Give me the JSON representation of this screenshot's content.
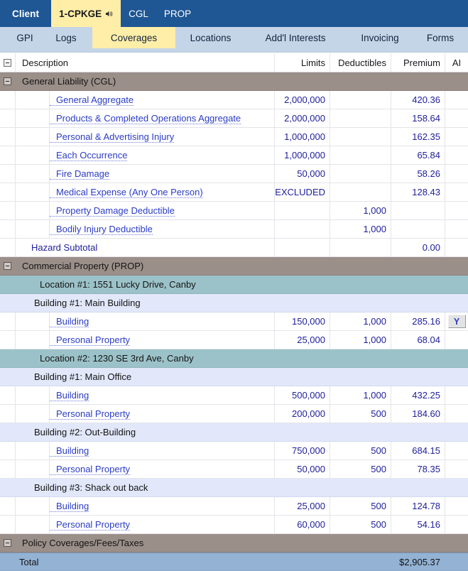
{
  "topbar": {
    "client_label": "Client",
    "tabs": [
      {
        "label": "1-CPKGE",
        "active": true,
        "icon": "speaker-icon"
      },
      {
        "label": "CGL",
        "active": false
      },
      {
        "label": "PROP",
        "active": false
      }
    ]
  },
  "subbar": {
    "tabs": [
      {
        "label": "GPI",
        "active": false
      },
      {
        "label": "Logs",
        "active": false
      },
      {
        "label": "Coverages",
        "active": true
      },
      {
        "label": "Locations",
        "active": false
      },
      {
        "label": "Add'l Interests",
        "active": false
      },
      {
        "label": "Invoicing",
        "active": false
      },
      {
        "label": "Forms",
        "active": false
      }
    ]
  },
  "grid": {
    "headers": {
      "description": "Description",
      "limits": "Limits",
      "deductibles": "Deductibles",
      "premium": "Premium",
      "ai": "AI"
    },
    "rows": [
      {
        "kind": "group",
        "desc": "General Liability (CGL)",
        "limits": "",
        "deductibles": "",
        "premium": "",
        "ai": ""
      },
      {
        "kind": "item",
        "desc": "General Aggregate",
        "limits": "2,000,000",
        "deductibles": "",
        "premium": "420.36",
        "ai": ""
      },
      {
        "kind": "item",
        "desc": "Products & Completed Operations Aggregate",
        "limits": "2,000,000",
        "deductibles": "",
        "premium": "158.64",
        "ai": ""
      },
      {
        "kind": "item",
        "desc": "Personal & Advertising Injury",
        "limits": "1,000,000",
        "deductibles": "",
        "premium": "162.35",
        "ai": ""
      },
      {
        "kind": "item",
        "desc": "Each Occurrence",
        "limits": "1,000,000",
        "deductibles": "",
        "premium": "65.84",
        "ai": ""
      },
      {
        "kind": "item",
        "desc": "Fire Damage",
        "limits": "50,000",
        "deductibles": "",
        "premium": "58.26",
        "ai": ""
      },
      {
        "kind": "item",
        "desc": "Medical Expense (Any One Person)",
        "limits": "EXCLUDED",
        "deductibles": "",
        "premium": "128.43",
        "ai": ""
      },
      {
        "kind": "item",
        "desc": "Property Damage Deductible",
        "limits": "",
        "deductibles": "1,000",
        "premium": "",
        "ai": ""
      },
      {
        "kind": "item",
        "desc": "Bodily Injury Deductible",
        "limits": "",
        "deductibles": "1,000",
        "premium": "",
        "ai": ""
      },
      {
        "kind": "subtotal",
        "desc": "Hazard Subtotal",
        "limits": "",
        "deductibles": "",
        "premium": "0.00",
        "ai": ""
      },
      {
        "kind": "group",
        "desc": "Commercial Property (PROP)",
        "limits": "",
        "deductibles": "",
        "premium": "",
        "ai": ""
      },
      {
        "kind": "loc",
        "desc": "Location #1: 1551 Lucky Drive, Canby",
        "limits": "",
        "deductibles": "",
        "premium": "",
        "ai": ""
      },
      {
        "kind": "bldg",
        "desc": "Building #1: Main Building",
        "limits": "",
        "deductibles": "",
        "premium": "",
        "ai": ""
      },
      {
        "kind": "item",
        "desc": "Building",
        "limits": "150,000",
        "deductibles": "1,000",
        "premium": "285.16",
        "ai": "Y"
      },
      {
        "kind": "item",
        "desc": "Personal Property",
        "limits": "25,000",
        "deductibles": "1,000",
        "premium": "68.04",
        "ai": ""
      },
      {
        "kind": "loc",
        "desc": "Location #2: 1230 SE 3rd Ave, Canby",
        "limits": "",
        "deductibles": "",
        "premium": "",
        "ai": ""
      },
      {
        "kind": "bldg",
        "desc": "Building #1: Main Office",
        "limits": "",
        "deductibles": "",
        "premium": "",
        "ai": ""
      },
      {
        "kind": "item",
        "desc": "Building",
        "limits": "500,000",
        "deductibles": "1,000",
        "premium": "432.25",
        "ai": ""
      },
      {
        "kind": "item",
        "desc": "Personal Property",
        "limits": "200,000",
        "deductibles": "500",
        "premium": "184.60",
        "ai": ""
      },
      {
        "kind": "bldg",
        "desc": "Building #2: Out-Building",
        "limits": "",
        "deductibles": "",
        "premium": "",
        "ai": ""
      },
      {
        "kind": "item",
        "desc": "Building",
        "limits": "750,000",
        "deductibles": "500",
        "premium": "684.15",
        "ai": ""
      },
      {
        "kind": "item",
        "desc": "Personal Property",
        "limits": "50,000",
        "deductibles": "500",
        "premium": "78.35",
        "ai": ""
      },
      {
        "kind": "bldg",
        "desc": "Building #3: Shack out back",
        "limits": "",
        "deductibles": "",
        "premium": "",
        "ai": ""
      },
      {
        "kind": "item",
        "desc": "Building",
        "limits": "25,000",
        "deductibles": "500",
        "premium": "124.78",
        "ai": ""
      },
      {
        "kind": "item",
        "desc": "Personal Property",
        "limits": "60,000",
        "deductibles": "500",
        "premium": "54.16",
        "ai": ""
      },
      {
        "kind": "group",
        "desc": "Policy Coverages/Fees/Taxes",
        "limits": "",
        "deductibles": "",
        "premium": "",
        "ai": ""
      },
      {
        "kind": "total",
        "desc": "Total",
        "limits": "",
        "deductibles": "",
        "premium": "$2,905.37",
        "ai": ""
      }
    ]
  },
  "colors": {
    "topbar_blue": "#1f5694",
    "active_tab_yellow": "#ffeea8",
    "subbar_blue": "#c5d5e8",
    "group_taupe": "#9b8f89",
    "location_teal": "#9cc2c9",
    "building_blue": "#e2e8fa",
    "total_blue": "#93b2d4",
    "link_blue": "#2b3cc4"
  }
}
